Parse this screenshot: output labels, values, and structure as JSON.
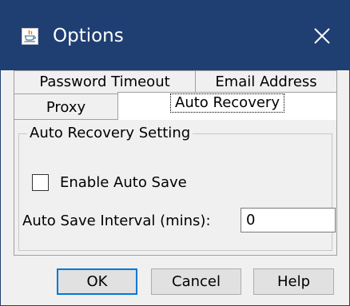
{
  "window": {
    "title": "Options",
    "icons": {
      "app": "java-cup-icon",
      "close": "close-icon"
    },
    "colors": {
      "titlebar": "#1f3f73",
      "focus_accent": "#0078d7"
    }
  },
  "tabs": [
    {
      "label": "Password Timeout",
      "selected": false
    },
    {
      "label": "Email Address",
      "selected": false
    },
    {
      "label": "Proxy",
      "selected": false
    },
    {
      "label": "Auto Recovery",
      "selected": true
    }
  ],
  "auto_recovery": {
    "group_title": "Auto Recovery Setting",
    "enable_auto_save": {
      "label": "Enable Auto Save",
      "checked": false
    },
    "interval": {
      "label": "Auto Save Interval (mins):",
      "value": "0"
    }
  },
  "buttons": {
    "ok": "OK",
    "cancel": "Cancel",
    "help": "Help"
  }
}
